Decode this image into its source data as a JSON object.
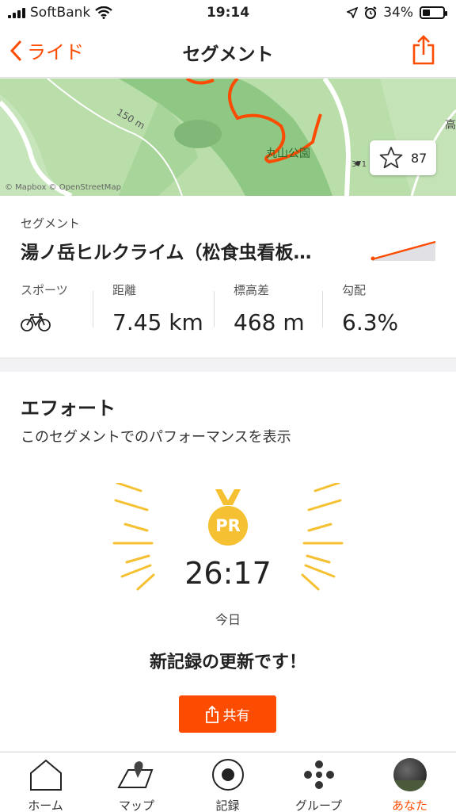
{
  "status_bar": {
    "carrier": "SoftBank",
    "time": "19:14",
    "battery": "34%"
  },
  "nav": {
    "back_label": "ライド",
    "title": "セグメント"
  },
  "map": {
    "labels": {
      "distance_marker": "150 m",
      "park": "丸山公園",
      "route_number": "371",
      "edge_char": "高"
    },
    "attribution": "© Mapbox © OpenStreetMap",
    "star_count": "87"
  },
  "segment": {
    "label": "セグメント",
    "name": "湯ノ岳ヒルクライム（松食虫看板…",
    "stats": [
      {
        "label": "スポーツ",
        "icon": "bike-icon"
      },
      {
        "label": "距離",
        "value": "7.45 km"
      },
      {
        "label": "標高差",
        "value": "468 m"
      },
      {
        "label": "勾配",
        "value": "6.3%"
      }
    ]
  },
  "effort": {
    "title": "エフォート",
    "subtitle": "このセグメントでのパフォーマンスを表示",
    "badge": "PR",
    "time": "26:17",
    "date": "今日",
    "message": "新記録の更新です！",
    "share_label": "共有"
  },
  "tabs": [
    {
      "label": "ホーム",
      "icon": "home-icon"
    },
    {
      "label": "マップ",
      "icon": "map-icon"
    },
    {
      "label": "記録",
      "icon": "record-icon"
    },
    {
      "label": "グループ",
      "icon": "groups-icon"
    },
    {
      "label": "あなた",
      "icon": "avatar",
      "active": true
    }
  ],
  "colors": {
    "accent": "#fc4c02",
    "medal": "#f5c133",
    "map_green": "#b9dea9"
  }
}
